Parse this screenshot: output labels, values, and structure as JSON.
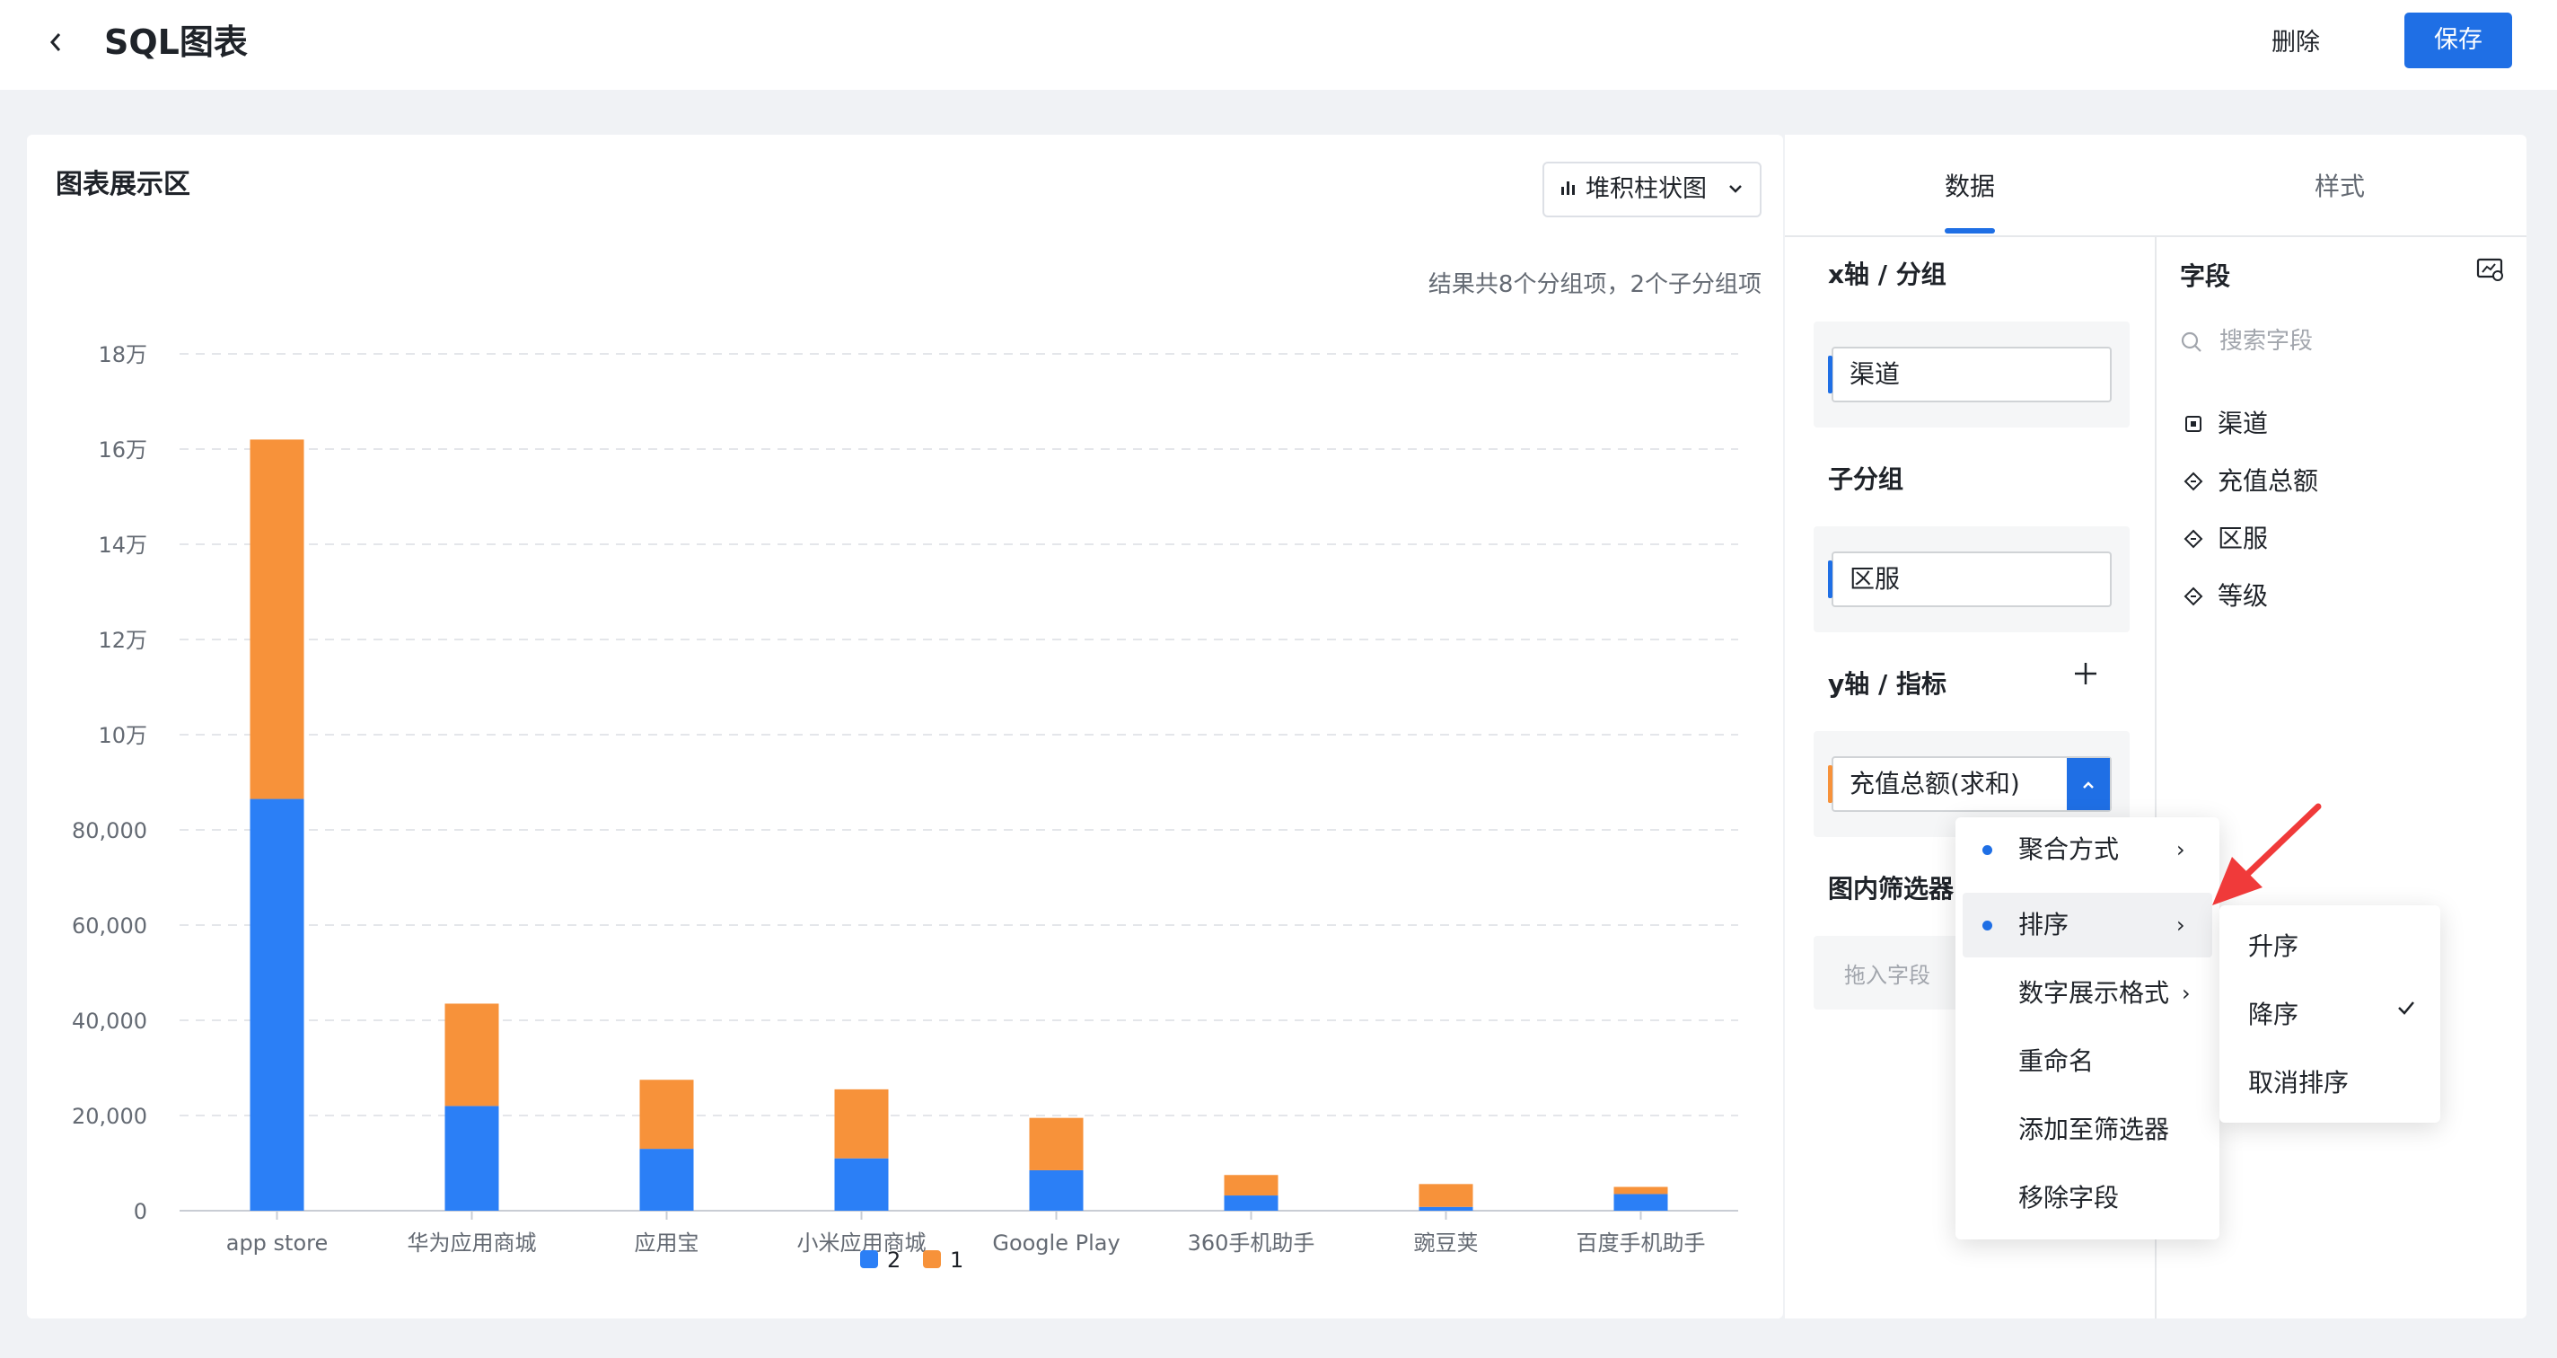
{
  "header": {
    "back_icon": "chevron-left-icon",
    "title": "SQL图表",
    "delete_label": "删除",
    "save_label": "保存"
  },
  "chart_card": {
    "title": "图表展示区",
    "chart_type_label": "堆积柱状图",
    "result_info": "结果共8个分组项，2个子分组项"
  },
  "chart_data": {
    "type": "bar",
    "stacked": true,
    "categories": [
      "app store",
      "华为应用商城",
      "应用宝",
      "小米应用商城",
      "Google Play",
      "360手机助手",
      "豌豆荚",
      "百度手机助手"
    ],
    "series": [
      {
        "name": "2",
        "color": "#2b7ff6",
        "values": [
          86500,
          22000,
          13000,
          11000,
          8500,
          3200,
          800,
          3500
        ]
      },
      {
        "name": "1",
        "color": "#f7923a",
        "values": [
          75500,
          21500,
          14500,
          14500,
          11000,
          4300,
          4800,
          1500
        ]
      }
    ],
    "ylim": [
      0,
      180000
    ],
    "yticks": [
      0,
      20000,
      40000,
      60000,
      80000,
      100000,
      120000,
      140000,
      160000,
      180000
    ],
    "ytick_labels": [
      "0",
      "20,000",
      "40,000",
      "60,000",
      "80,000",
      "10万",
      "12万",
      "14万",
      "16万",
      "18万"
    ],
    "grid": true,
    "legend": "bottom-center"
  },
  "panel": {
    "tabs": [
      "数据",
      "样式"
    ],
    "active_tab": "数据",
    "x_axis": {
      "title": "x轴 / 分组",
      "field": "渠道",
      "color": "#1f6fe5"
    },
    "sub_group": {
      "title": "子分组",
      "field": "区服",
      "color": "#1f6fe5"
    },
    "y_axis": {
      "title": "y轴 / 指标",
      "field": "充值总额(求和)",
      "color": "#f7923a"
    },
    "filter": {
      "title": "图内筛选器",
      "placeholder": "拖入字段"
    },
    "fields": {
      "title": "字段",
      "search_placeholder": "搜索字段",
      "items": [
        {
          "label": "渠道",
          "icon": "dimension-icon"
        },
        {
          "label": "充值总额",
          "icon": "measure-icon"
        },
        {
          "label": "区服",
          "icon": "measure-icon"
        },
        {
          "label": "等级",
          "icon": "measure-icon"
        }
      ]
    }
  },
  "context_menu": {
    "items": [
      "聚合方式",
      "排序",
      "数字展示格式",
      "重命名",
      "添加至筛选器",
      "移除字段"
    ],
    "submenu": {
      "items": [
        "升序",
        "降序",
        "取消排序"
      ],
      "checked": "降序"
    }
  }
}
